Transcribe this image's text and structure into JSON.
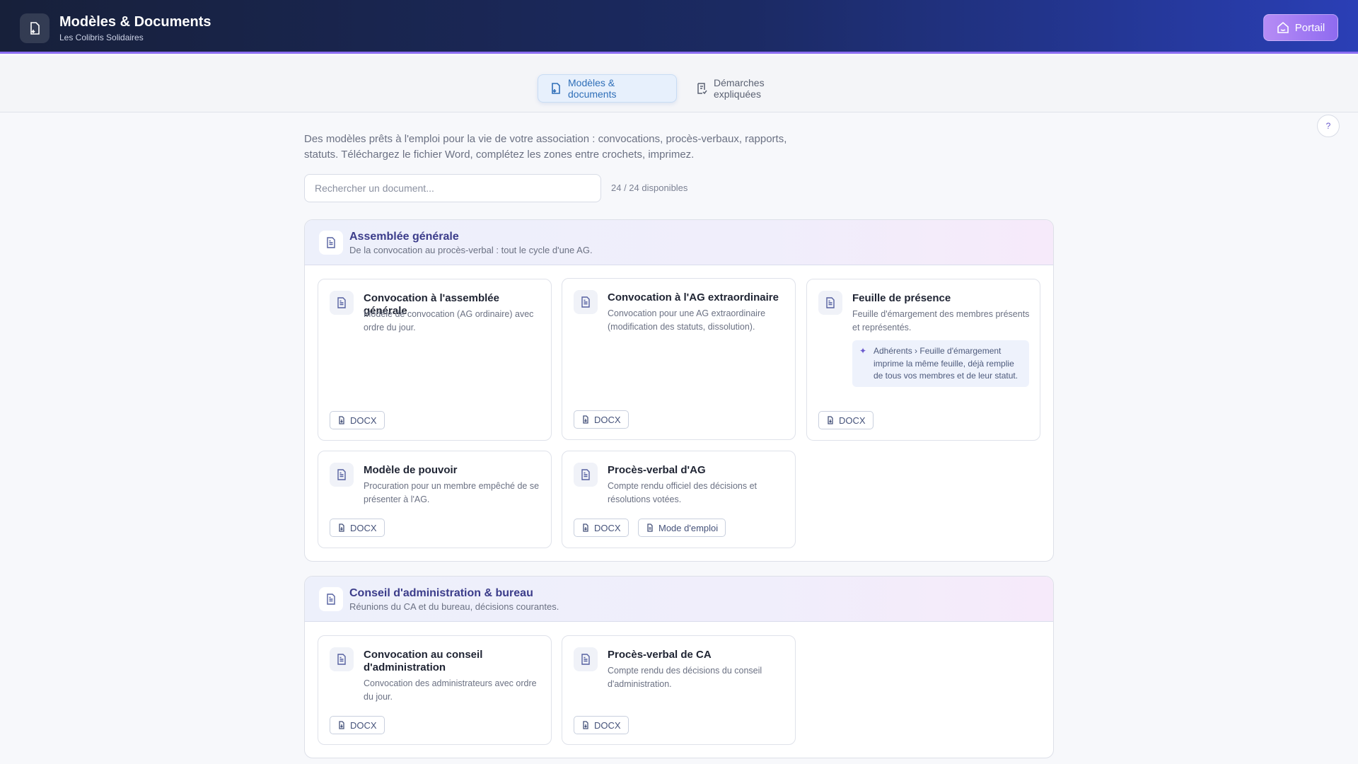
{
  "header": {
    "title": "Modèles & Documents",
    "subtitle": "Les Colibris Solidaires",
    "portal_label": "Portail",
    "gradient_colors": [
      "#17203a",
      "#2a3fb6"
    ]
  },
  "tabs": [
    {
      "label": "Modèles & documents",
      "icon": "document-download-icon",
      "active": true
    },
    {
      "label": "Démarches expliquées",
      "icon": "checklist-icon",
      "active": false
    }
  ],
  "help": {
    "label": "?"
  },
  "intro": {
    "text": "Des modèles prêts à l'emploi pour la vie de votre association : convocations, procès-verbaux, rapports, statuts. Téléchargez le fichier Word, complétez les zones entre crochets, imprimez."
  },
  "search": {
    "placeholder": "Rechercher un document...",
    "count_label": "24 / 24 disponibles"
  },
  "sections": [
    {
      "title": "Assemblée générale",
      "subtitle": "De la convocation au procès-verbal : tout le cycle d'une AG.",
      "cards": [
        {
          "title": "Convocation à l'assemblée générale",
          "desc": "Modèle de convocation (AG ordinaire) avec ordre du jour.",
          "buttons": [
            "DOCX"
          ]
        },
        {
          "title": "Convocation à l'AG extraordinaire",
          "desc": "Convocation pour une AG extraordinaire (modification des statuts, dissolution).",
          "buttons": [
            "DOCX"
          ]
        },
        {
          "title": "Feuille de présence",
          "desc": "Feuille d'émargement des membres présents et représentés.",
          "note": "Adhérents › Feuille d'émargement imprime la même feuille, déjà remplie de tous vos membres et de leur statut.",
          "buttons": [
            "DOCX"
          ]
        },
        {
          "title": "Modèle de pouvoir",
          "desc": "Procuration pour un membre empêché de se présenter à l'AG.",
          "buttons": [
            "DOCX"
          ]
        },
        {
          "title": "Procès-verbal d'AG",
          "desc": "Compte rendu officiel des décisions et résolutions votées.",
          "buttons": [
            "DOCX",
            "Mode d'emploi"
          ]
        }
      ]
    },
    {
      "title": "Conseil d'administration & bureau",
      "subtitle": "Réunions du CA et du bureau, décisions courantes.",
      "cards": [
        {
          "title": "Convocation au conseil d'administration",
          "desc": "Convocation des administrateurs avec ordre du jour.",
          "buttons": [
            "DOCX"
          ]
        },
        {
          "title": "Procès-verbal de CA",
          "desc": "Compte rendu des décisions du conseil d'administration.",
          "buttons": [
            "DOCX"
          ]
        }
      ]
    }
  ]
}
